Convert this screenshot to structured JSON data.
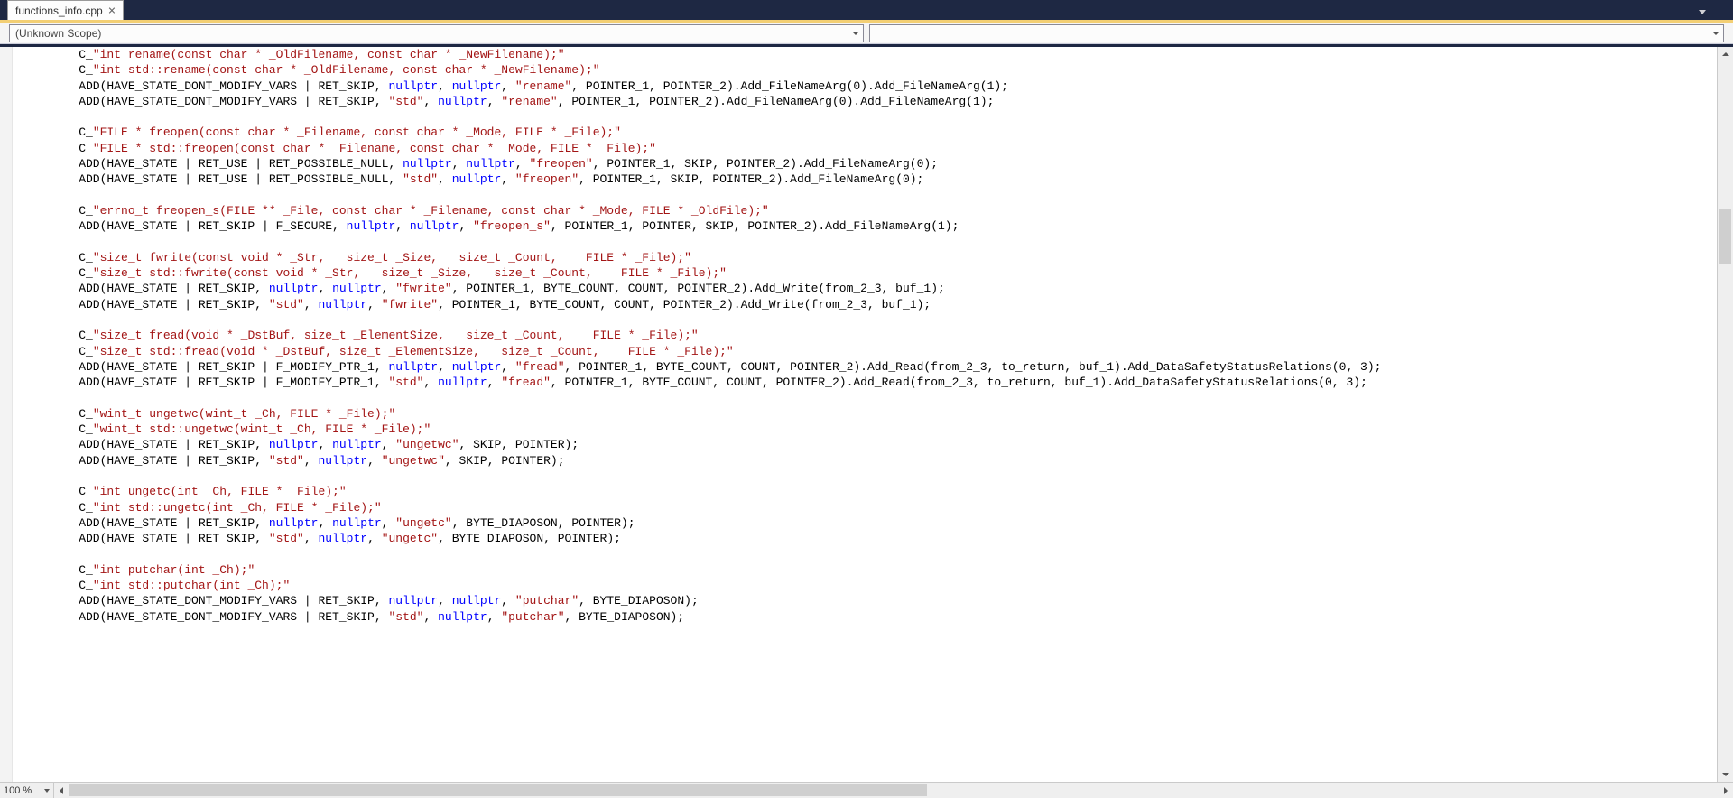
{
  "tab": {
    "title": "functions_info.cpp"
  },
  "nav": {
    "scope": "(Unknown Scope)",
    "member": ""
  },
  "zoom": "100 %",
  "colors": {
    "string": "#a31515",
    "keyword": "#0000ff",
    "text": "#000000",
    "tabAccent": "#f3cf74",
    "chrome": "#1e2843"
  },
  "code_lines": [
    [
      [
        "t",
        "    C_"
      ],
      [
        "s",
        "\"int rename(const char * _OldFilename, const char * _NewFilename);\""
      ]
    ],
    [
      [
        "t",
        "    C_"
      ],
      [
        "s",
        "\"int std::rename(const char * _OldFilename, const char * _NewFilename);\""
      ]
    ],
    [
      [
        "t",
        "    ADD(HAVE_STATE_DONT_MODIFY_VARS | RET_SKIP, "
      ],
      [
        "k",
        "nullptr"
      ],
      [
        "t",
        ", "
      ],
      [
        "k",
        "nullptr"
      ],
      [
        "t",
        ", "
      ],
      [
        "s",
        "\"rename\""
      ],
      [
        "t",
        ", POINTER_1, POINTER_2).Add_FileNameArg(0).Add_FileNameArg(1);"
      ]
    ],
    [
      [
        "t",
        "    ADD(HAVE_STATE_DONT_MODIFY_VARS | RET_SKIP, "
      ],
      [
        "s",
        "\"std\""
      ],
      [
        "t",
        ", "
      ],
      [
        "k",
        "nullptr"
      ],
      [
        "t",
        ", "
      ],
      [
        "s",
        "\"rename\""
      ],
      [
        "t",
        ", POINTER_1, POINTER_2).Add_FileNameArg(0).Add_FileNameArg(1);"
      ]
    ],
    [
      [
        "t",
        ""
      ]
    ],
    [
      [
        "t",
        "    C_"
      ],
      [
        "s",
        "\"FILE * freopen(const char * _Filename, const char * _Mode, FILE * _File);\""
      ]
    ],
    [
      [
        "t",
        "    C_"
      ],
      [
        "s",
        "\"FILE * std::freopen(const char * _Filename, const char * _Mode, FILE * _File);\""
      ]
    ],
    [
      [
        "t",
        "    ADD(HAVE_STATE | RET_USE | RET_POSSIBLE_NULL, "
      ],
      [
        "k",
        "nullptr"
      ],
      [
        "t",
        ", "
      ],
      [
        "k",
        "nullptr"
      ],
      [
        "t",
        ", "
      ],
      [
        "s",
        "\"freopen\""
      ],
      [
        "t",
        ", POINTER_1, SKIP, POINTER_2).Add_FileNameArg(0);"
      ]
    ],
    [
      [
        "t",
        "    ADD(HAVE_STATE | RET_USE | RET_POSSIBLE_NULL, "
      ],
      [
        "s",
        "\"std\""
      ],
      [
        "t",
        ", "
      ],
      [
        "k",
        "nullptr"
      ],
      [
        "t",
        ", "
      ],
      [
        "s",
        "\"freopen\""
      ],
      [
        "t",
        ", POINTER_1, SKIP, POINTER_2).Add_FileNameArg(0);"
      ]
    ],
    [
      [
        "t",
        ""
      ]
    ],
    [
      [
        "t",
        "    C_"
      ],
      [
        "s",
        "\"errno_t freopen_s(FILE ** _File, const char * _Filename, const char * _Mode, FILE * _OldFile);\""
      ]
    ],
    [
      [
        "t",
        "    ADD(HAVE_STATE | RET_SKIP | F_SECURE, "
      ],
      [
        "k",
        "nullptr"
      ],
      [
        "t",
        ", "
      ],
      [
        "k",
        "nullptr"
      ],
      [
        "t",
        ", "
      ],
      [
        "s",
        "\"freopen_s\""
      ],
      [
        "t",
        ", POINTER_1, POINTER, SKIP, POINTER_2).Add_FileNameArg(1);"
      ]
    ],
    [
      [
        "t",
        ""
      ]
    ],
    [
      [
        "t",
        "    C_"
      ],
      [
        "s",
        "\"size_t fwrite(const void * _Str,   size_t _Size,   size_t _Count,    FILE * _File);\""
      ]
    ],
    [
      [
        "t",
        "    C_"
      ],
      [
        "s",
        "\"size_t std::fwrite(const void * _Str,   size_t _Size,   size_t _Count,    FILE * _File);\""
      ]
    ],
    [
      [
        "t",
        "    ADD(HAVE_STATE | RET_SKIP, "
      ],
      [
        "k",
        "nullptr"
      ],
      [
        "t",
        ", "
      ],
      [
        "k",
        "nullptr"
      ],
      [
        "t",
        ", "
      ],
      [
        "s",
        "\"fwrite\""
      ],
      [
        "t",
        ", POINTER_1, BYTE_COUNT, COUNT, POINTER_2).Add_Write(from_2_3, buf_1);"
      ]
    ],
    [
      [
        "t",
        "    ADD(HAVE_STATE | RET_SKIP, "
      ],
      [
        "s",
        "\"std\""
      ],
      [
        "t",
        ", "
      ],
      [
        "k",
        "nullptr"
      ],
      [
        "t",
        ", "
      ],
      [
        "s",
        "\"fwrite\""
      ],
      [
        "t",
        ", POINTER_1, BYTE_COUNT, COUNT, POINTER_2).Add_Write(from_2_3, buf_1);"
      ]
    ],
    [
      [
        "t",
        ""
      ]
    ],
    [
      [
        "t",
        "    C_"
      ],
      [
        "s",
        "\"size_t fread(void * _DstBuf, size_t _ElementSize,   size_t _Count,    FILE * _File);\""
      ]
    ],
    [
      [
        "t",
        "    C_"
      ],
      [
        "s",
        "\"size_t std::fread(void * _DstBuf, size_t _ElementSize,   size_t _Count,    FILE * _File);\""
      ]
    ],
    [
      [
        "t",
        "    ADD(HAVE_STATE | RET_SKIP | F_MODIFY_PTR_1, "
      ],
      [
        "k",
        "nullptr"
      ],
      [
        "t",
        ", "
      ],
      [
        "k",
        "nullptr"
      ],
      [
        "t",
        ", "
      ],
      [
        "s",
        "\"fread\""
      ],
      [
        "t",
        ", POINTER_1, BYTE_COUNT, COUNT, POINTER_2).Add_Read(from_2_3, to_return, buf_1).Add_DataSafetyStatusRelations(0, 3);"
      ]
    ],
    [
      [
        "t",
        "    ADD(HAVE_STATE | RET_SKIP | F_MODIFY_PTR_1, "
      ],
      [
        "s",
        "\"std\""
      ],
      [
        "t",
        ", "
      ],
      [
        "k",
        "nullptr"
      ],
      [
        "t",
        ", "
      ],
      [
        "s",
        "\"fread\""
      ],
      [
        "t",
        ", POINTER_1, BYTE_COUNT, COUNT, POINTER_2).Add_Read(from_2_3, to_return, buf_1).Add_DataSafetyStatusRelations(0, 3);"
      ]
    ],
    [
      [
        "t",
        ""
      ]
    ],
    [
      [
        "t",
        "    C_"
      ],
      [
        "s",
        "\"wint_t ungetwc(wint_t _Ch, FILE * _File);\""
      ]
    ],
    [
      [
        "t",
        "    C_"
      ],
      [
        "s",
        "\"wint_t std::ungetwc(wint_t _Ch, FILE * _File);\""
      ]
    ],
    [
      [
        "t",
        "    ADD(HAVE_STATE | RET_SKIP, "
      ],
      [
        "k",
        "nullptr"
      ],
      [
        "t",
        ", "
      ],
      [
        "k",
        "nullptr"
      ],
      [
        "t",
        ", "
      ],
      [
        "s",
        "\"ungetwc\""
      ],
      [
        "t",
        ", SKIP, POINTER);"
      ]
    ],
    [
      [
        "t",
        "    ADD(HAVE_STATE | RET_SKIP, "
      ],
      [
        "s",
        "\"std\""
      ],
      [
        "t",
        ", "
      ],
      [
        "k",
        "nullptr"
      ],
      [
        "t",
        ", "
      ],
      [
        "s",
        "\"ungetwc\""
      ],
      [
        "t",
        ", SKIP, POINTER);"
      ]
    ],
    [
      [
        "t",
        ""
      ]
    ],
    [
      [
        "t",
        "    C_"
      ],
      [
        "s",
        "\"int ungetc(int _Ch, FILE * _File);\""
      ]
    ],
    [
      [
        "t",
        "    C_"
      ],
      [
        "s",
        "\"int std::ungetc(int _Ch, FILE * _File);\""
      ]
    ],
    [
      [
        "t",
        "    ADD(HAVE_STATE | RET_SKIP, "
      ],
      [
        "k",
        "nullptr"
      ],
      [
        "t",
        ", "
      ],
      [
        "k",
        "nullptr"
      ],
      [
        "t",
        ", "
      ],
      [
        "s",
        "\"ungetc\""
      ],
      [
        "t",
        ", BYTE_DIAPOSON, POINTER);"
      ]
    ],
    [
      [
        "t",
        "    ADD(HAVE_STATE | RET_SKIP, "
      ],
      [
        "s",
        "\"std\""
      ],
      [
        "t",
        ", "
      ],
      [
        "k",
        "nullptr"
      ],
      [
        "t",
        ", "
      ],
      [
        "s",
        "\"ungetc\""
      ],
      [
        "t",
        ", BYTE_DIAPOSON, POINTER);"
      ]
    ],
    [
      [
        "t",
        ""
      ]
    ],
    [
      [
        "t",
        "    C_"
      ],
      [
        "s",
        "\"int putchar(int _Ch);\""
      ]
    ],
    [
      [
        "t",
        "    C_"
      ],
      [
        "s",
        "\"int std::putchar(int _Ch);\""
      ]
    ],
    [
      [
        "t",
        "    ADD(HAVE_STATE_DONT_MODIFY_VARS | RET_SKIP, "
      ],
      [
        "k",
        "nullptr"
      ],
      [
        "t",
        ", "
      ],
      [
        "k",
        "nullptr"
      ],
      [
        "t",
        ", "
      ],
      [
        "s",
        "\"putchar\""
      ],
      [
        "t",
        ", BYTE_DIAPOSON);"
      ]
    ],
    [
      [
        "t",
        "    ADD(HAVE_STATE_DONT_MODIFY_VARS | RET_SKIP, "
      ],
      [
        "s",
        "\"std\""
      ],
      [
        "t",
        ", "
      ],
      [
        "k",
        "nullptr"
      ],
      [
        "t",
        ", "
      ],
      [
        "s",
        "\"putchar\""
      ],
      [
        "t",
        ", BYTE_DIAPOSON);"
      ]
    ]
  ]
}
